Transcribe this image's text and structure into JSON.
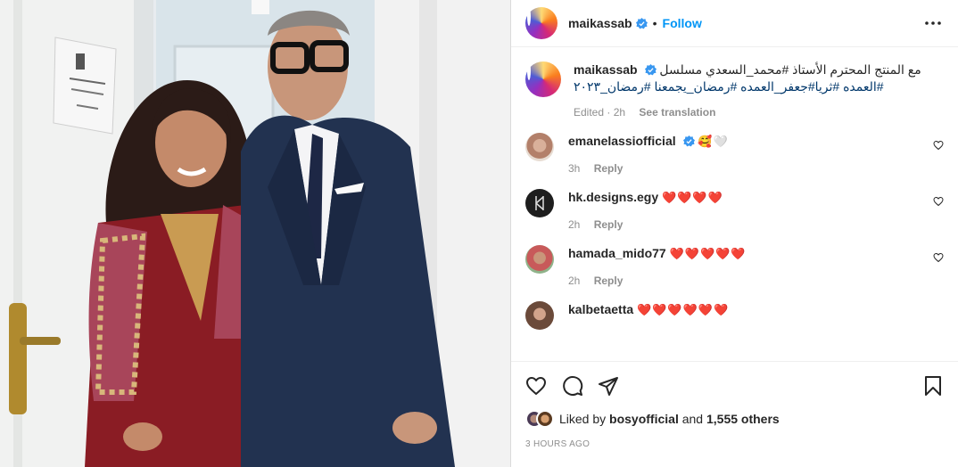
{
  "post": {
    "username": "maikassab",
    "dot": "•",
    "follow_label": "Follow",
    "caption": {
      "username": "maikassab",
      "text": "مع المنتج المحترم الأستاذ #محمد_السعدي مسلسل",
      "hashtags": "#العمده #ثريا#جعفر_العمده #رمضان_يجمعنا #رمضان_٢٠٢٣",
      "edited": "Edited · 2h",
      "see_translation": "See translation"
    }
  },
  "comments": [
    {
      "username": "emanelassiofficial",
      "verified": true,
      "text": "🥰🤍",
      "time": "3h",
      "reply": "Reply"
    },
    {
      "username": "hk.designs.egy",
      "verified": false,
      "text": "❤️❤️❤️❤️",
      "time": "2h",
      "reply": "Reply"
    },
    {
      "username": "hamada_mido77",
      "verified": false,
      "text": "❤️❤️❤️❤️❤️",
      "time": "2h",
      "reply": "Reply"
    },
    {
      "username": "kalbetaetta",
      "verified": false,
      "text": "❤️❤️❤️❤️❤️❤️",
      "time": "",
      "reply": ""
    }
  ],
  "likes": {
    "prefix": "Liked by",
    "user": "bosyofficial",
    "mid": "and",
    "others": "1,555 others"
  },
  "timestamp": "3 HOURS AGO",
  "icons": {
    "more": "more-horizontal-icon",
    "like": "heart-icon",
    "comment": "comment-icon",
    "share": "share-icon",
    "save": "bookmark-icon"
  },
  "colors": {
    "accent": "#0095f6",
    "hashtag": "#00376b",
    "muted": "#8e8e8e",
    "verified": "#3897f0"
  }
}
